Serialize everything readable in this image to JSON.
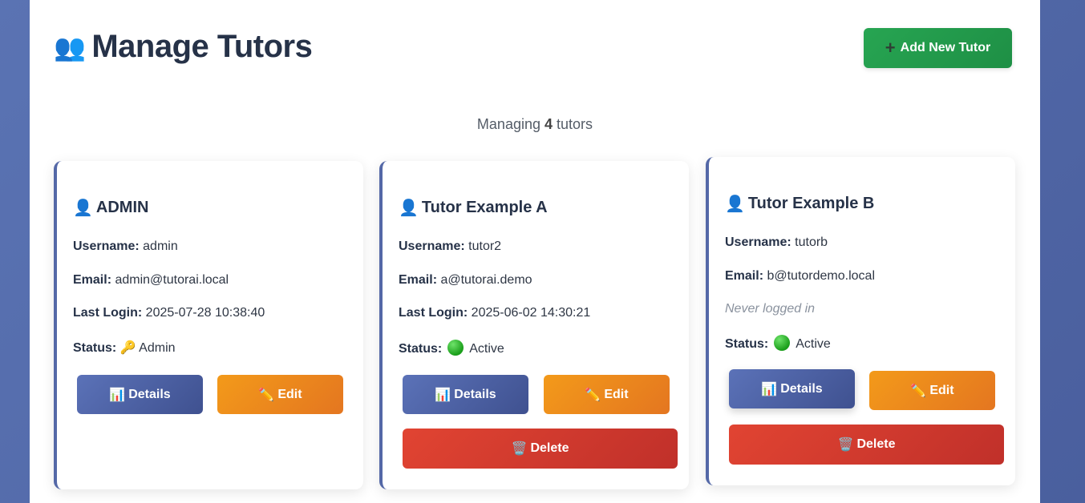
{
  "header": {
    "title_icon": "people-icon",
    "title": "Manage Tutors",
    "add_button_icon": "plus-icon",
    "add_button_label": "Add New Tutor"
  },
  "summary": {
    "prefix": "Managing",
    "count": "4",
    "suffix": "tutors"
  },
  "labels": {
    "username": "Username:",
    "email": "Email:",
    "last_login": "Last Login:",
    "status": "Status:",
    "details": "Details",
    "edit": "Edit",
    "delete": "Delete"
  },
  "tutors": [
    {
      "name": "ADMIN",
      "username": "admin",
      "email": "admin@tutorai.local",
      "last_login": "2025-07-28 10:38:40",
      "status_icon": "key-icon",
      "status": "Admin"
    },
    {
      "name": "Tutor Example A",
      "username": "tutor2",
      "email": "a@tutorai.demo",
      "last_login": "2025-06-02 14:30:21",
      "status_icon": "green-circle-icon",
      "status": "Active"
    },
    {
      "name": "Tutor Example B",
      "username": "tutorb",
      "email": "b@tutordemo.local",
      "never_logged_in": "Never logged in",
      "status_icon": "green-circle-icon",
      "status": "Active"
    }
  ],
  "colors": {
    "background": "#5a73b3",
    "add_button": "#27a552",
    "details_button": "#4f65a8",
    "edit_button": "#ee8a1c",
    "delete_button": "#d63b2f",
    "card_accent": "#5468a7",
    "title_text": "#263248"
  }
}
